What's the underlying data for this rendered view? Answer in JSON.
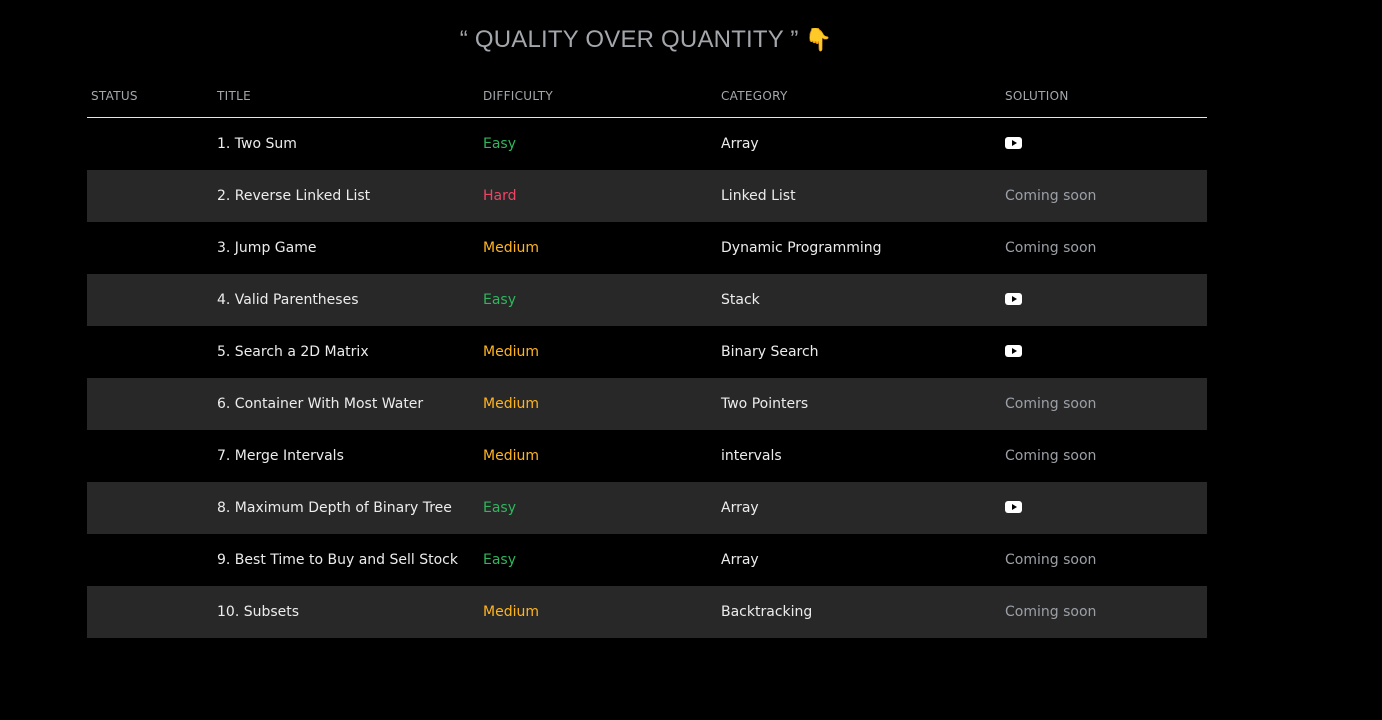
{
  "heading": {
    "text": "“ QUALITY OVER QUANTITY ”",
    "emoji": "👇"
  },
  "columns": {
    "status": "STATUS",
    "title": "TITLE",
    "difficulty": "DIFFICULTY",
    "category": "CATEGORY",
    "solution": "SOLUTION"
  },
  "rows": [
    {
      "title": "1. Two Sum",
      "difficulty": "Easy",
      "difficulty_level": "easy",
      "category": "Array",
      "solution": "youtube-icon",
      "solution_text": ""
    },
    {
      "title": "2. Reverse Linked List",
      "difficulty": "Hard",
      "difficulty_level": "hard",
      "category": "Linked List",
      "solution": "text",
      "solution_text": "Coming soon"
    },
    {
      "title": "3. Jump Game",
      "difficulty": "Medium",
      "difficulty_level": "medium",
      "category": "Dynamic Programming",
      "solution": "text",
      "solution_text": "Coming soon"
    },
    {
      "title": "4. Valid Parentheses",
      "difficulty": "Easy",
      "difficulty_level": "easy",
      "category": "Stack",
      "solution": "youtube-icon",
      "solution_text": ""
    },
    {
      "title": "5. Search a 2D Matrix",
      "difficulty": "Medium",
      "difficulty_level": "medium",
      "category": "Binary Search",
      "solution": "youtube-icon",
      "solution_text": ""
    },
    {
      "title": "6. Container With Most Water",
      "difficulty": "Medium",
      "difficulty_level": "medium",
      "category": "Two Pointers",
      "solution": "text",
      "solution_text": "Coming soon"
    },
    {
      "title": "7. Merge Intervals",
      "difficulty": "Medium",
      "difficulty_level": "medium",
      "category": "intervals",
      "solution": "text",
      "solution_text": "Coming soon"
    },
    {
      "title": "8. Maximum Depth of Binary Tree",
      "difficulty": "Easy",
      "difficulty_level": "easy",
      "category": "Array",
      "solution": "youtube-icon",
      "solution_text": ""
    },
    {
      "title": "9. Best Time to Buy and Sell Stock",
      "difficulty": "Easy",
      "difficulty_level": "easy",
      "category": "Array",
      "solution": "text",
      "solution_text": "Coming soon"
    },
    {
      "title": "10. Subsets",
      "difficulty": "Medium",
      "difficulty_level": "medium",
      "category": "Backtracking",
      "solution": "text",
      "solution_text": "Coming soon"
    }
  ],
  "colors": {
    "background": "#000000",
    "row_alt": "#282828",
    "easy": "#2fb55d",
    "medium": "#ffb420",
    "hard": "#ef4565",
    "muted": "#9ca0a6"
  }
}
